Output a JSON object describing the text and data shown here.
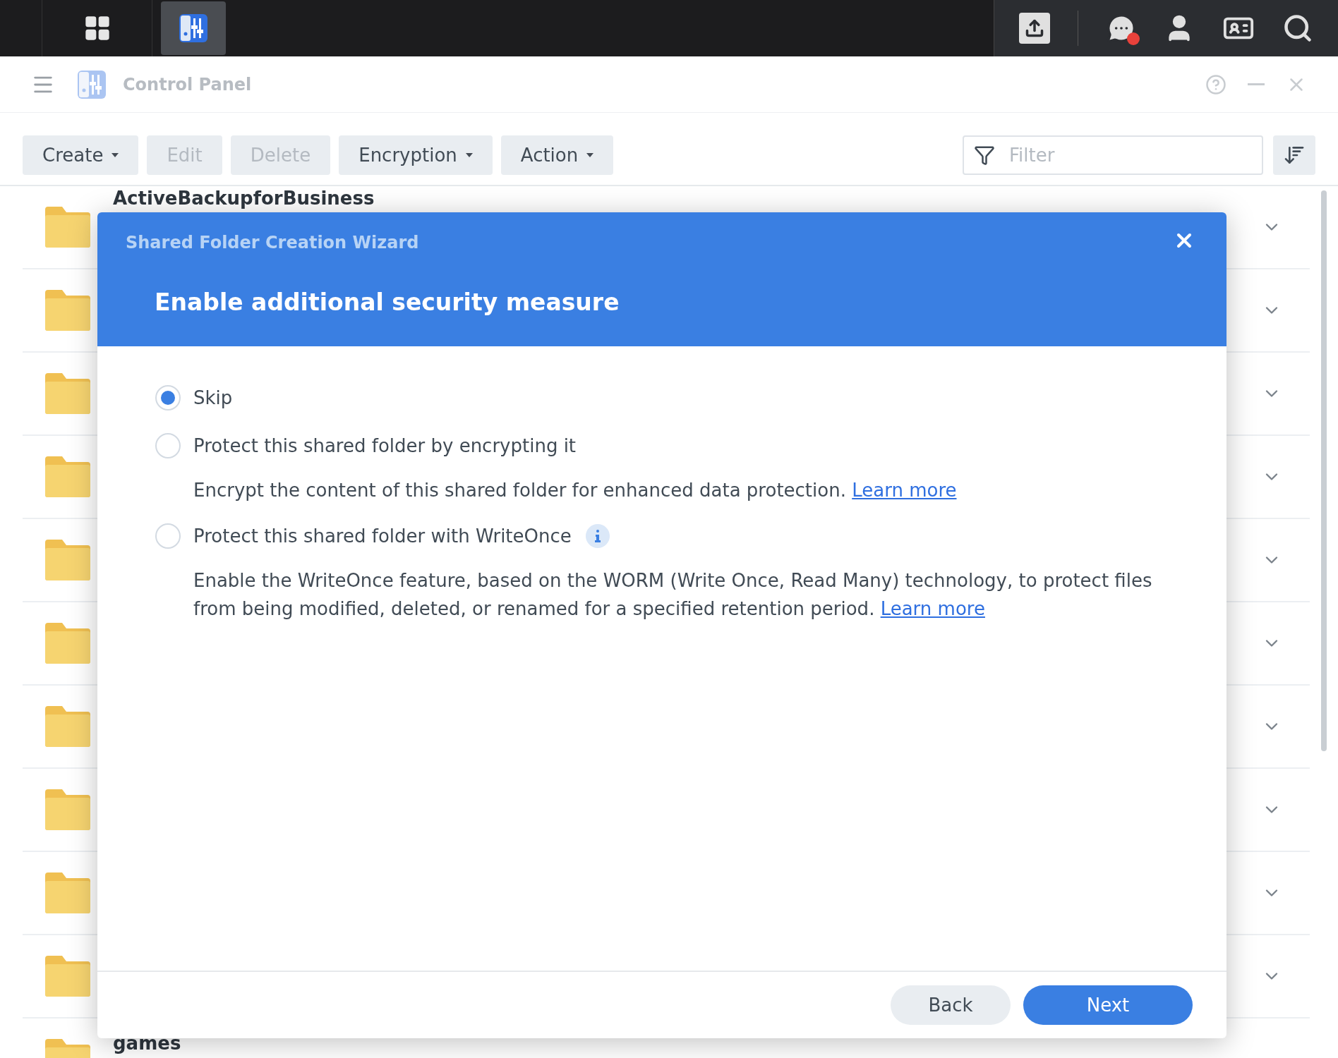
{
  "window": {
    "title": "Control Panel"
  },
  "toolbar": {
    "buttons": [
      {
        "label": "Create",
        "dropdown": true,
        "disabled": false
      },
      {
        "label": "Edit",
        "dropdown": false,
        "disabled": true
      },
      {
        "label": "Delete",
        "dropdown": false,
        "disabled": true
      },
      {
        "label": "Encryption",
        "dropdown": true,
        "disabled": false
      },
      {
        "label": "Action",
        "dropdown": true,
        "disabled": false
      }
    ],
    "filter": {
      "placeholder": "Filter"
    }
  },
  "folders": [
    {
      "name": "ActiveBackupforBusiness",
      "expandable": true
    },
    {
      "expandable": true
    },
    {
      "expandable": true
    },
    {
      "expandable": true
    },
    {
      "expandable": true
    },
    {
      "expandable": true
    },
    {
      "expandable": true
    },
    {
      "expandable": true
    },
    {
      "expandable": true
    },
    {
      "expandable": true
    },
    {
      "name": "games",
      "expandable": false
    }
  ],
  "dialog": {
    "title": "Shared Folder Creation Wizard",
    "heading": "Enable additional security measure",
    "options": [
      {
        "label": "Skip",
        "selected": true
      },
      {
        "label": "Protect this shared folder by encrypting it",
        "selected": false,
        "description": "Encrypt the content of this shared folder for enhanced data protection.",
        "link": "Learn more"
      },
      {
        "label": "Protect this shared folder with WriteOnce",
        "selected": false,
        "info": true,
        "description": "Enable the WriteOnce feature, based on the WORM (Write Once, Read Many) technology, to protect files from being modified, deleted, or renamed for a specified retention period.",
        "link": "Learn more"
      }
    ],
    "buttons": [
      {
        "label": "Back",
        "kind": "secondary"
      },
      {
        "label": "Next",
        "kind": "primary"
      }
    ]
  }
}
